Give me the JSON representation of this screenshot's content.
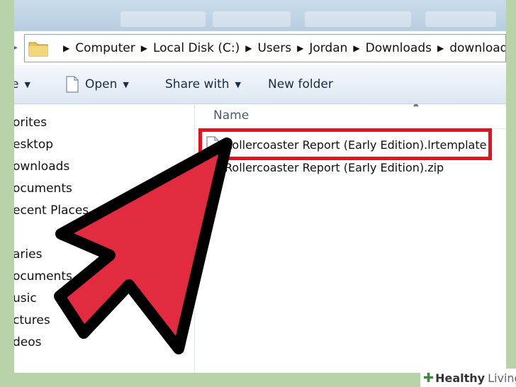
{
  "address_bar": {
    "crumbs": [
      "Computer",
      "Local Disk (C:)",
      "Users",
      "Jordan",
      "Downloads",
      "download"
    ]
  },
  "toolbar": {
    "organize_partial": "e",
    "open_label": "Open",
    "share_label": "Share with",
    "new_folder_label": "New folder"
  },
  "sidebar": {
    "items": [
      "orites",
      "esktop",
      "ownloads",
      "ocuments",
      "ecent Places",
      "aries",
      "ocuments",
      "usic",
      "ctures",
      "deos"
    ]
  },
  "file_list": {
    "column_name": "Name",
    "files": [
      {
        "name": "Rollercoaster Report (Early Edition).lrtemplate",
        "icon": "document-icon",
        "selected": true
      },
      {
        "name": "Rollercoaster Report (Early Edition).zip",
        "icon": "zip-archive-icon",
        "selected": false
      }
    ]
  },
  "annotation": {
    "highlight_color": "#e8101e",
    "arrow_color": "#e22b3f"
  },
  "watermark": {
    "brand_bold": "Healthy",
    "brand_light": "Living"
  }
}
